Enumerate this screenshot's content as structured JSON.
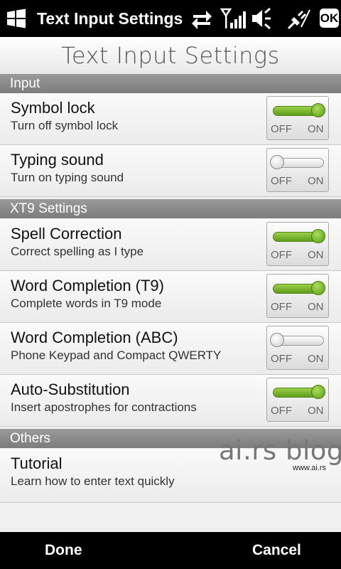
{
  "status_bar": {
    "title": "Text Input Settings",
    "ok_label": "OK",
    "icons": [
      "windows-start-icon",
      "sync-arrows-icon",
      "signal-strength-icon",
      "volume-muted-icon",
      "power-plug-icon"
    ]
  },
  "page": {
    "title": "Text Input Settings"
  },
  "sections": {
    "input": {
      "title": "Input"
    },
    "xt9": {
      "title": "XT9 Settings"
    },
    "others": {
      "title": "Others"
    }
  },
  "settings": {
    "symbol_lock": {
      "label": "Symbol lock",
      "description": "Turn off symbol lock",
      "state": "on"
    },
    "typing_sound": {
      "label": "Typing sound",
      "description": "Turn on typing sound",
      "state": "off"
    },
    "spell_correction": {
      "label": "Spell Correction",
      "description": "Correct spelling as I type",
      "state": "on"
    },
    "word_completion_t9": {
      "label": "Word Completion (T9)",
      "description": "Complete words in T9 mode",
      "state": "on"
    },
    "word_completion_abc": {
      "label": "Word Completion (ABC)",
      "description": "Phone Keypad and Compact QWERTY",
      "state": "off"
    },
    "auto_substitution": {
      "label": "Auto-Substitution",
      "description": "Insert apostrophes for contractions",
      "state": "on"
    },
    "tutorial": {
      "label": "Tutorial",
      "description": "Learn how to enter text quickly"
    }
  },
  "toggle_labels": {
    "off": "OFF",
    "on": "ON"
  },
  "watermark": {
    "text": "ai.rs blog",
    "url": "www.ai.rs"
  },
  "softkeys": {
    "left": "Done",
    "right": "Cancel"
  },
  "colors": {
    "toggle_on": "#6aac22",
    "section_header": "#8a8a8a",
    "bars": "#000000"
  }
}
